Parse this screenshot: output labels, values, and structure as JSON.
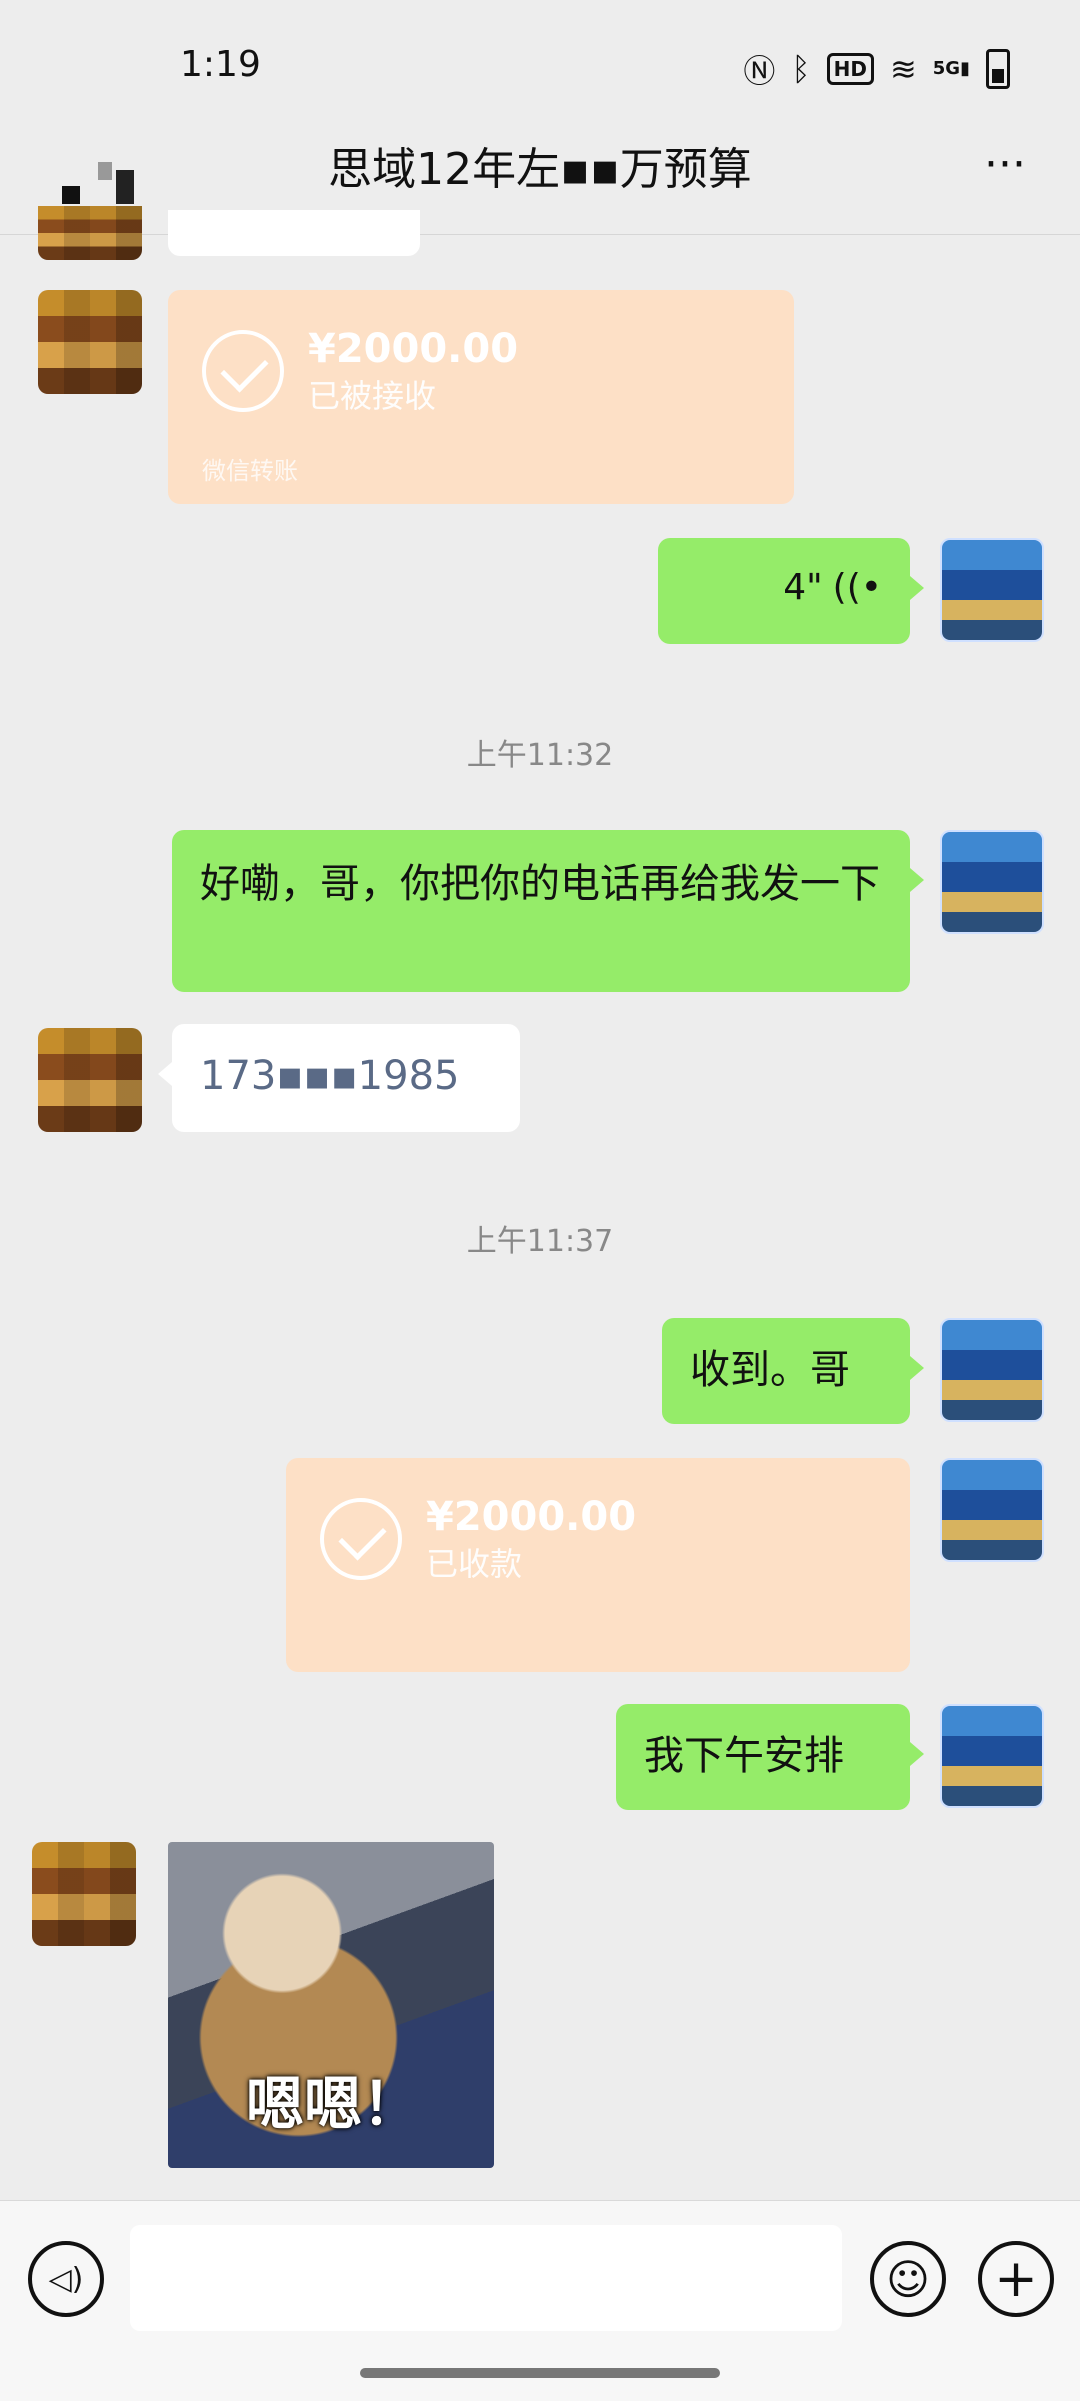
{
  "status_bar": {
    "time": "1:19",
    "icons": [
      "nfc-icon",
      "bluetooth-icon",
      "hd-icon",
      "wifi-icon",
      "5g-signal-icon",
      "battery-icon"
    ],
    "hd_label": "HD",
    "network_label": "5G"
  },
  "header": {
    "title": "思域12年左▪▪万预算",
    "more_label": "···"
  },
  "messages": {
    "transfer1": {
      "amount": "¥2000.00",
      "status": "已被接收",
      "footer": "微信转账"
    },
    "voice1": {
      "duration": "4\"",
      "icon": "voice-wave-icon"
    },
    "time1": "上午11:32",
    "text1": "好嘞，哥，你把你的电话再给我发一下",
    "phone": "173▪▪▪1985",
    "time2": "上午11:37",
    "text2": "收到。哥",
    "transfer2": {
      "amount": "¥2000.00",
      "status": "已收款"
    },
    "text3": "我下午安排",
    "sticker_caption": "嗯嗯！"
  },
  "bottom_bar": {
    "input_placeholder": "",
    "voice_glyph": "◁)",
    "emoji_glyph": "☺",
    "plus_glyph": "+"
  },
  "colors": {
    "bg": "#ededed",
    "self_bubble": "#95ec69",
    "transfer": "#fde0c6"
  }
}
